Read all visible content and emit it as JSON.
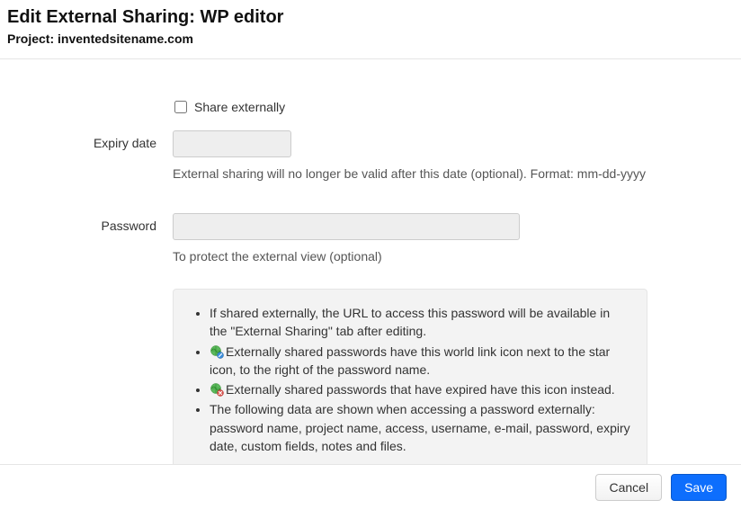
{
  "header": {
    "title": "Edit External Sharing: WP editor",
    "project_label": "Project: inventedsitename.com"
  },
  "share_checkbox": {
    "label": "Share externally",
    "checked": false
  },
  "expiry": {
    "label": "Expiry date",
    "value": "",
    "help": "External sharing will no longer be valid after this date (optional). Format: mm-dd-yyyy"
  },
  "password": {
    "label": "Password",
    "value": "",
    "help": "To protect the external view (optional)"
  },
  "info": {
    "items": [
      "If shared externally, the URL to access this password will be available in the \"External Sharing\" tab after editing.",
      "Externally shared passwords have this world link icon next to the star icon, to the right of the password name.",
      "Externally shared passwords that have expired have this icon instead.",
      "The following data are shown when accessing a password externally: password name, project name, access, username, e-mail, password, expiry date, custom fields, notes and files."
    ]
  },
  "footer": {
    "cancel": "Cancel",
    "save": "Save"
  }
}
